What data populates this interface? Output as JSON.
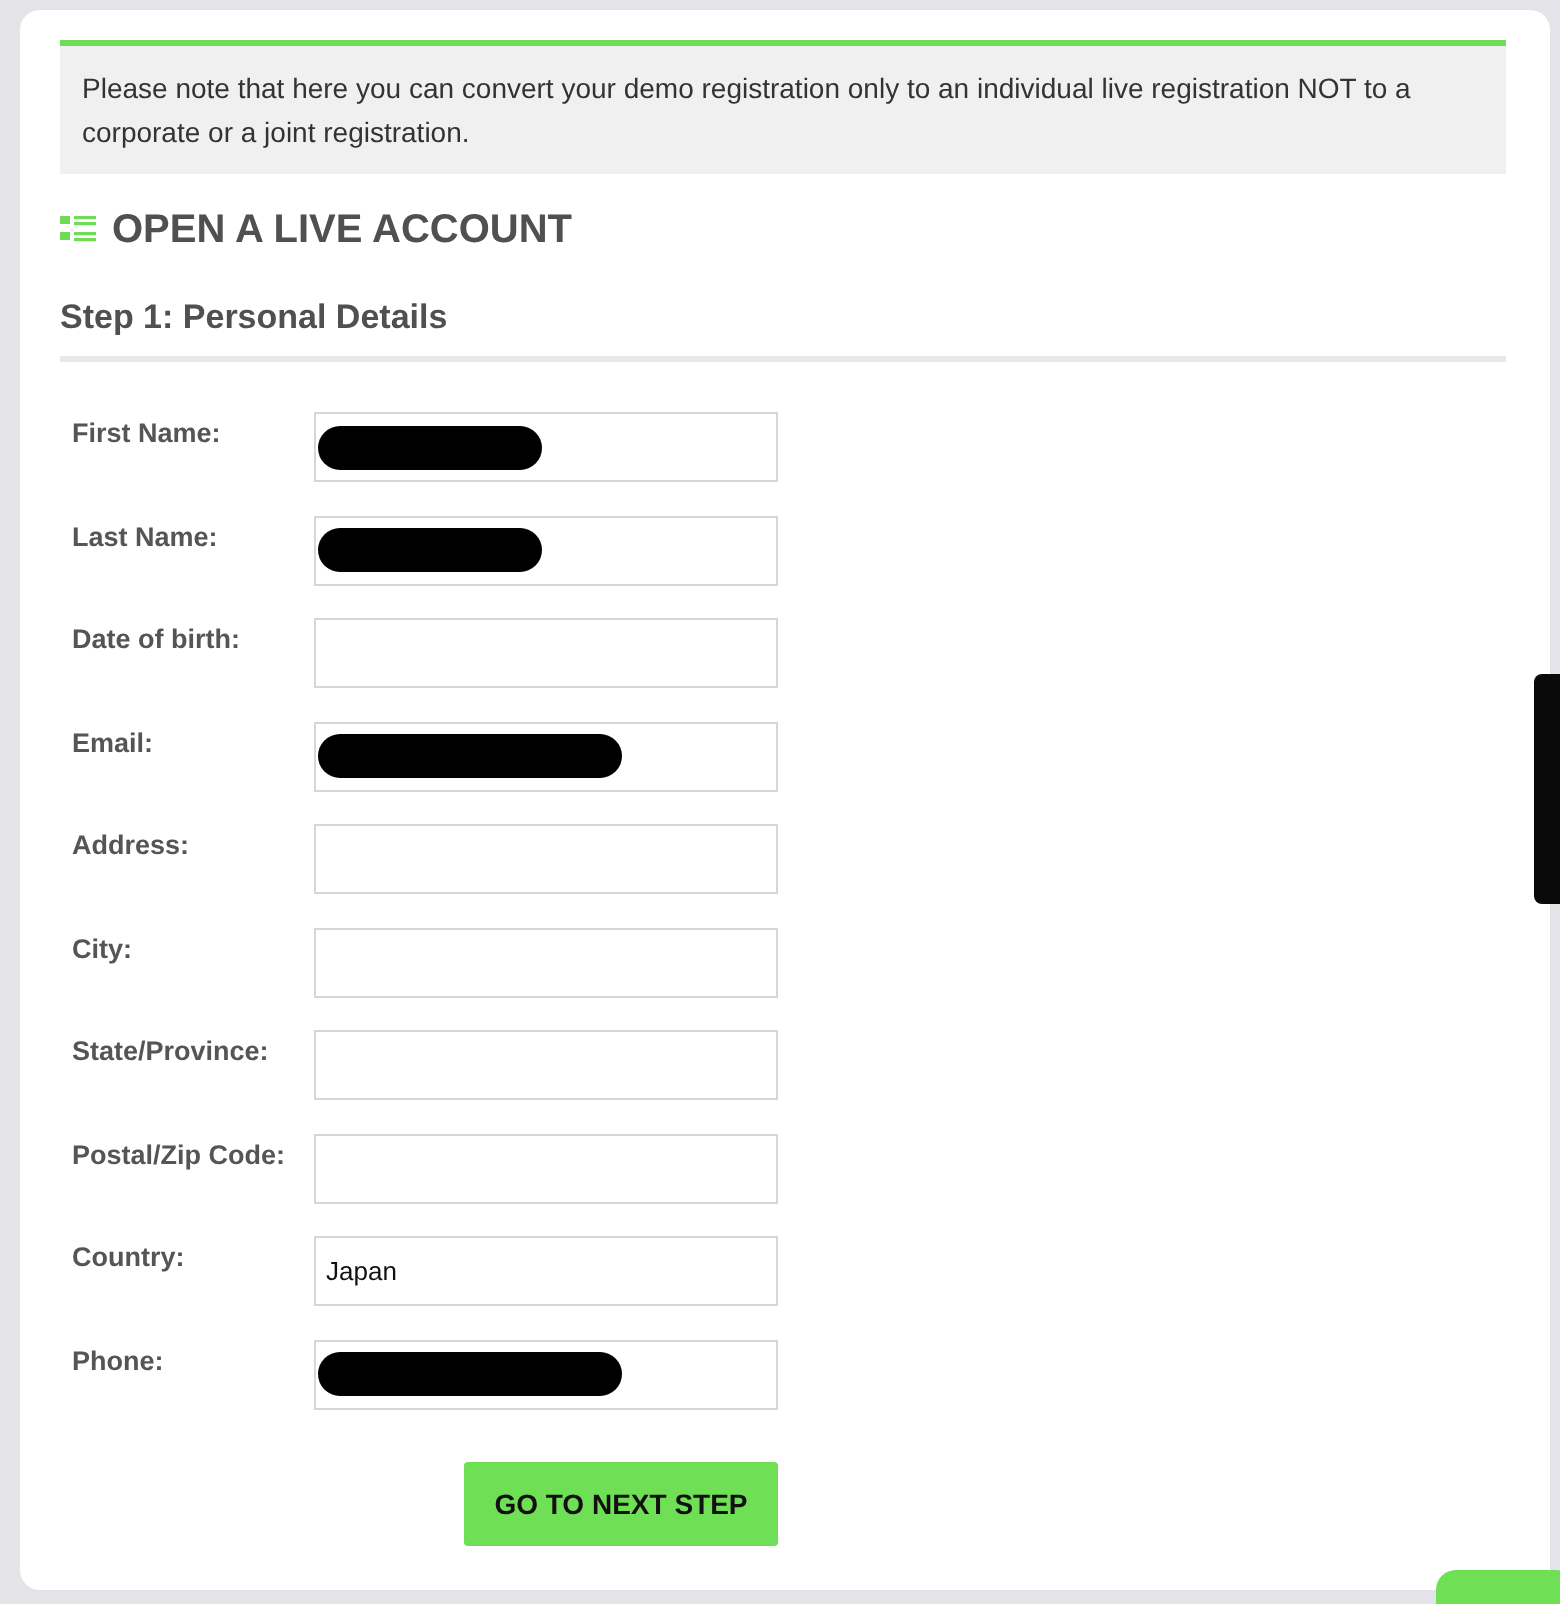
{
  "notice": "Please note that here you can convert your demo registration only to an individual live registration NOT to a corporate or a joint registration.",
  "heading": "OPEN A LIVE ACCOUNT",
  "step": "Step 1: Personal Details",
  "fields": [
    {
      "label": "First Name:",
      "kind": "mask"
    },
    {
      "label": "Last Name:",
      "kind": "mask"
    },
    {
      "label": "Date of birth:",
      "kind": "blank"
    },
    {
      "label": "Email:",
      "kind": "longmask"
    },
    {
      "label": "Address:",
      "kind": "blank"
    },
    {
      "label": "City:",
      "kind": "blank"
    },
    {
      "label": "State/Province:",
      "kind": "blank"
    },
    {
      "label": "Postal/Zip Code:",
      "kind": "blank"
    },
    {
      "label": "Country:",
      "kind": "text",
      "value": "Japan"
    },
    {
      "label": "Phone:",
      "kind": "longmask"
    }
  ],
  "button": "GO TO NEXT STEP"
}
